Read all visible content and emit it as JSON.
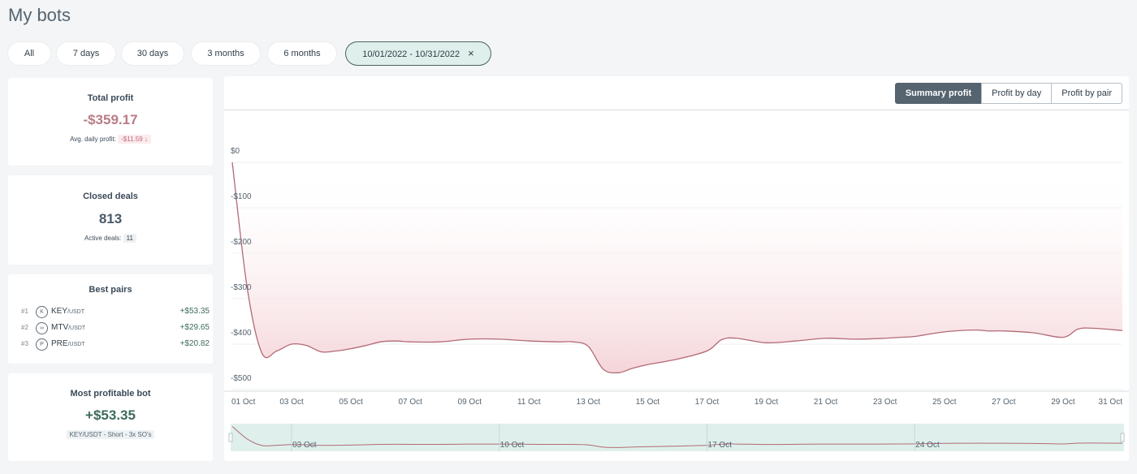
{
  "page": {
    "title": "My bots"
  },
  "filters": [
    {
      "label": "All"
    },
    {
      "label": "7 days"
    },
    {
      "label": "30 days"
    },
    {
      "label": "3 months"
    },
    {
      "label": "6 months"
    },
    {
      "label": "10/01/2022 - 10/31/2022",
      "active": true,
      "close_icon": "×"
    }
  ],
  "total_profit": {
    "title": "Total profit",
    "value": "-$359.17",
    "avg_label": "Avg. daily profit:",
    "avg_value": "-$11.59",
    "trend_icon": "↓"
  },
  "closed_deals": {
    "title": "Closed deals",
    "value": "813",
    "active_label": "Active deals:",
    "active_value": "11"
  },
  "best_pairs": {
    "title": "Best pairs",
    "items": [
      {
        "rank": "#1",
        "base": "KEY",
        "quote": "/USDT",
        "value": "+$53.35",
        "icon": "key-coin-icon"
      },
      {
        "rank": "#2",
        "base": "MTV",
        "quote": "/USDT",
        "value": "+$29.65",
        "icon": "mtv-coin-icon"
      },
      {
        "rank": "#3",
        "base": "PRE",
        "quote": "/USDT",
        "value": "+$20.82",
        "icon": "pre-coin-icon"
      }
    ]
  },
  "most_profitable_bot": {
    "title": "Most profitable bot",
    "value": "+$53.35",
    "bot_label": "KEY/USDT - Short - 3x SO's"
  },
  "chart_tabs": [
    {
      "label": "Summary profit",
      "active": true
    },
    {
      "label": "Profit by day",
      "active": false
    },
    {
      "label": "Profit by pair",
      "active": false
    }
  ],
  "colors": {
    "negative": "#b97c86",
    "positive": "#3d6b5a",
    "line": "#b26a76",
    "area_fill": "#f6d9dc",
    "navigator_fill": "#dff0ec"
  },
  "chart_data": {
    "type": "area",
    "title": "",
    "xlabel": "",
    "ylabel": "",
    "ylim": [
      -500,
      0
    ],
    "yticks": [
      "$0",
      "-$100",
      "-$200",
      "-$300",
      "-$400",
      "-$500"
    ],
    "x": [
      1,
      1.5,
      2,
      2.5,
      3,
      3.5,
      4,
      4.5,
      5,
      5.5,
      6,
      6.5,
      7,
      8,
      9,
      10,
      11,
      12,
      12.5,
      13,
      13.5,
      14,
      14.5,
      15,
      16,
      17,
      17.5,
      18,
      19,
      20,
      21,
      22,
      23,
      23.5,
      24,
      25,
      26,
      26.5,
      27,
      28,
      29,
      29.5,
      30,
      31
    ],
    "values": [
      -25,
      -300,
      -445,
      -440,
      -425,
      -428,
      -442,
      -440,
      -435,
      -428,
      -420,
      -418,
      -420,
      -420,
      -414,
      -414,
      -418,
      -420,
      -420,
      -430,
      -480,
      -488,
      -478,
      -470,
      -458,
      -440,
      -415,
      -412,
      -422,
      -418,
      -412,
      -414,
      -412,
      -410,
      -408,
      -398,
      -394,
      -396,
      -396,
      -400,
      -410,
      -392,
      -390,
      -395
    ],
    "xticks": [
      "01 Oct",
      "03 Oct",
      "05 Oct",
      "07 Oct",
      "09 Oct",
      "11 Oct",
      "13 Oct",
      "15 Oct",
      "17 Oct",
      "19 Oct",
      "21 Oct",
      "23 Oct",
      "25 Oct",
      "27 Oct",
      "29 Oct",
      "31 Oct"
    ],
    "navigator_ticks": [
      "03 Oct",
      "10 Oct",
      "17 Oct",
      "24 Oct"
    ],
    "grid": true
  }
}
